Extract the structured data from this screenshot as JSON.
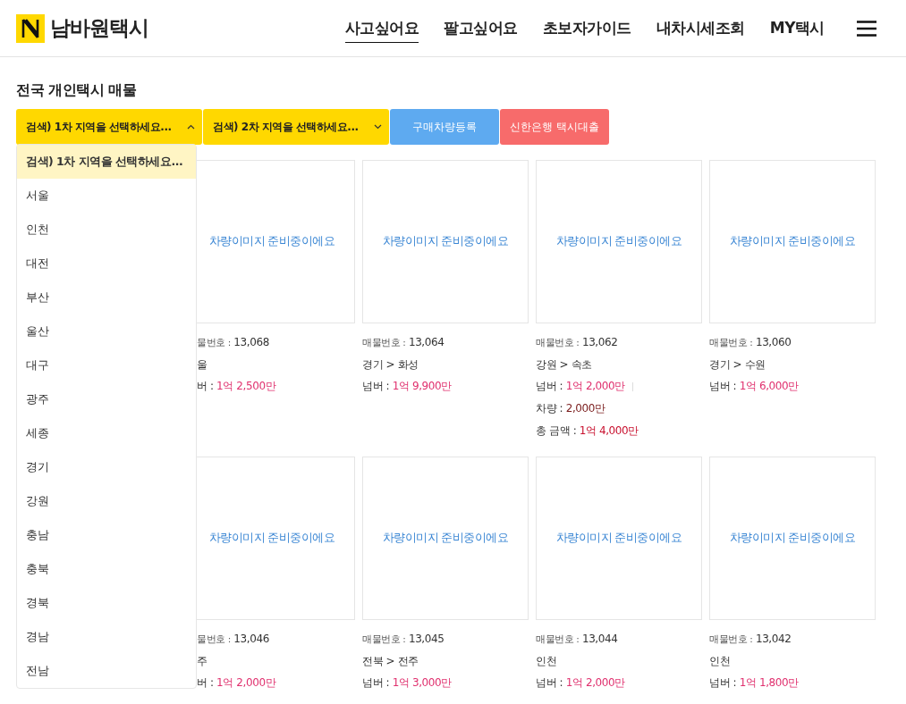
{
  "header": {
    "logo_text": "남바원택시",
    "nav": [
      {
        "label": "사고싶어요",
        "selected": true
      },
      {
        "label": "팔고싶어요",
        "selected": false
      },
      {
        "label": "초보자가이드",
        "selected": false
      },
      {
        "label": "내차시세조회",
        "selected": false
      },
      {
        "label": "MY택시",
        "selected": false
      }
    ]
  },
  "title": "전국 개인택시 매물",
  "filters": [
    {
      "kind": "select",
      "label": "검색)  1차 지역을 선택하세요...",
      "expanded": true
    },
    {
      "kind": "select",
      "label": "검색)  2차 지역을 선택하세요...",
      "expanded": false
    },
    {
      "kind": "register",
      "label": "구매차량등록"
    },
    {
      "kind": "loan",
      "label": "신한은행 택시대출"
    }
  ],
  "dropdown": {
    "options": [
      {
        "label": "검색)  1차 지역을 선택하세요...",
        "selected": true
      },
      {
        "label": "서울",
        "selected": false
      },
      {
        "label": "인천",
        "selected": false
      },
      {
        "label": "대전",
        "selected": false
      },
      {
        "label": "부산",
        "selected": false
      },
      {
        "label": "울산",
        "selected": false
      },
      {
        "label": "대구",
        "selected": false
      },
      {
        "label": "광주",
        "selected": false
      },
      {
        "label": "세종",
        "selected": false
      },
      {
        "label": "경기",
        "selected": false
      },
      {
        "label": "강원",
        "selected": false
      },
      {
        "label": "충남",
        "selected": false
      },
      {
        "label": "충북",
        "selected": false
      },
      {
        "label": "경북",
        "selected": false
      },
      {
        "label": "경남",
        "selected": false
      },
      {
        "label": "전남",
        "selected": false
      }
    ]
  },
  "listings": [
    {
      "cut": true,
      "image_text": "차량이미지 준비중이에요",
      "number_label": "물번호 :",
      "number": "13,068",
      "location": "울",
      "prices": [
        {
          "kind": "plate",
          "label": "버 :",
          "value": "1억 2,500만"
        }
      ]
    },
    {
      "cut": false,
      "image_text": "차량이미지 준비중이에요",
      "number_label": "매물번호 :",
      "number": "13,064",
      "location": "경기 > 화성",
      "prices": [
        {
          "kind": "plate",
          "label": "넘버 :",
          "value": "1억 9,900만"
        }
      ]
    },
    {
      "cut": false,
      "image_text": "차량이미지 준비중이에요",
      "number_label": "매물번호 :",
      "number": "13,062",
      "location": "강원 > 속초",
      "prices": [
        {
          "kind": "plate",
          "label": "넘버 :",
          "value": "1억 2,000만"
        },
        {
          "kind": "car",
          "label": "차량 :",
          "value": "2,000만"
        },
        {
          "kind": "total",
          "label": "총 금액 :",
          "value": "1억 4,000만"
        }
      ]
    },
    {
      "cut": false,
      "image_text": "차량이미지 준비중이에요",
      "number_label": "매물번호 :",
      "number": "13,060",
      "location": "경기 > 수원",
      "prices": [
        {
          "kind": "plate",
          "label": "넘버 :",
          "value": "1억 6,000만"
        }
      ]
    },
    {
      "cut": true,
      "image_text": "차량이미지 준비중이에요",
      "number_label": "물번호 :",
      "number": "13,046",
      "location": "주",
      "prices": [
        {
          "kind": "plate",
          "label": "버 :",
          "value": "1억 2,000만"
        }
      ]
    },
    {
      "cut": false,
      "image_text": "차량이미지 준비중이에요",
      "number_label": "매물번호 :",
      "number": "13,045",
      "location": "전북 > 전주",
      "prices": [
        {
          "kind": "plate",
          "label": "넘버 :",
          "value": "1억 3,000만"
        }
      ]
    },
    {
      "cut": false,
      "image_text": "차량이미지 준비중이에요",
      "number_label": "매물번호 :",
      "number": "13,044",
      "location": "인천",
      "prices": [
        {
          "kind": "plate",
          "label": "넘버 :",
          "value": "1억 2,000만"
        }
      ]
    },
    {
      "cut": false,
      "image_text": "차량이미지 준비중이에요",
      "number_label": "매물번호 :",
      "number": "13,042",
      "location": "인천",
      "prices": [
        {
          "kind": "plate",
          "label": "넘버 :",
          "value": "1억 1,800만"
        }
      ]
    }
  ]
}
